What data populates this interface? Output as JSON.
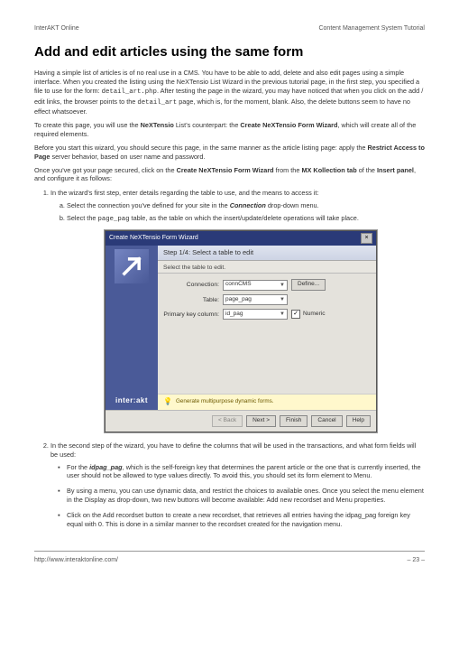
{
  "header": {
    "left": "InterAKT Online",
    "right": "Content Management System Tutorial"
  },
  "title": "Add and edit articles using the same form",
  "para1_a": "Having a simple list of articles is of no real use in a CMS. You have to be able to add, delete  and also edit pages using a simple interface. When you created the listing using the NeXTensio List Wizard in the previous tutorial page, in the first step, you specified a file to use for the form: ",
  "para1_code1": "detail_art.php",
  "para1_b": ". After testing the page in the wizard, you may have noticed that when you click on the add / edit links, the browser points to the ",
  "para1_code2": "detail_art",
  "para1_c": " page, which is, for the moment, blank. Also, the delete buttons seem to have no effect whatsoever.",
  "para2_a": "To create this page, you will use the ",
  "para2_b1": "NeXTensio",
  "para2_b": " List's counterpart: the ",
  "para2_b2": "Create NeXTensio Form Wizard",
  "para2_c": ", which will create all of the required elements.",
  "para3_a": "Before you start this wizard, you should secure this page, in the same manner as the article listing page: apply the ",
  "para3_b1": "Restrict Access to Page",
  "para3_b": " server behavior, based on user name and password.",
  "para4_a": "Once you've got your page secured, click on the ",
  "para4_b1": "Create NeXTensio Form Wizard",
  "para4_b": " from the ",
  "para4_b2": "MX Kollection tab",
  "para4_c": " of the ",
  "para4_b3": "Insert panel",
  "para4_d": ", and configure it as follows:",
  "ol1_li1": "In the wizard's first step, enter details regarding the table to use, and the means to access it:",
  "ol1_a_a": "Select the connection you've defined for your site in the ",
  "ol1_a_bi": "Connection",
  "ol1_a_b": " drop-down menu.",
  "ol1_b_a": "Select the ",
  "ol1_b_code": "page_pag",
  "ol1_b_b": " table, as the table on which the insert/update/delete operations will take place.",
  "wizard": {
    "title": "Create NeXTensio Form Wizard",
    "step": "Step 1/4: Select a table to edit",
    "subtitle": "Select the table to edit.",
    "labels": {
      "connection": "Connection:",
      "table": "Table:",
      "pk": "Primary key column:"
    },
    "values": {
      "connection": "connCMS",
      "table": "page_pag",
      "pk": "id_pag"
    },
    "define": "Define...",
    "numeric": "Numeric",
    "hint": "Generate multipurpose dynamic forms.",
    "buttons": {
      "back": "< Back",
      "next": "Next >",
      "finish": "Finish",
      "cancel": "Cancel",
      "help": "Help"
    },
    "brand": "inter:akt"
  },
  "ol1_li2": "In the second step of the wizard, you have to define the columns that will be used in the transactions, and what form fields will be used:",
  "bul1_a": "For the ",
  "bul1_bi": "idpag_pag",
  "bul1_b": ", which is the self-foreign key that determines the parent article or the one that is currently inserted, the user should not be allowed to type values directly. To avoid this, you should set its form element to Menu.",
  "bul2": "By using a menu, you can use dynamic data, and restrict the choices to available ones. Once you select the menu element in the Display as drop-down, two new buttons will become available: Add new recordset and Menu properties.",
  "bul3": "Click on the Add recordset button to create a new recordset, that retrieves all entries having the idpag_pag foreign key equal with 0. This is done in a similar manner to the recordset created for the navigation menu.",
  "footer": {
    "url": "http://www.interaktonline.com/",
    "page": "– 23 –"
  }
}
